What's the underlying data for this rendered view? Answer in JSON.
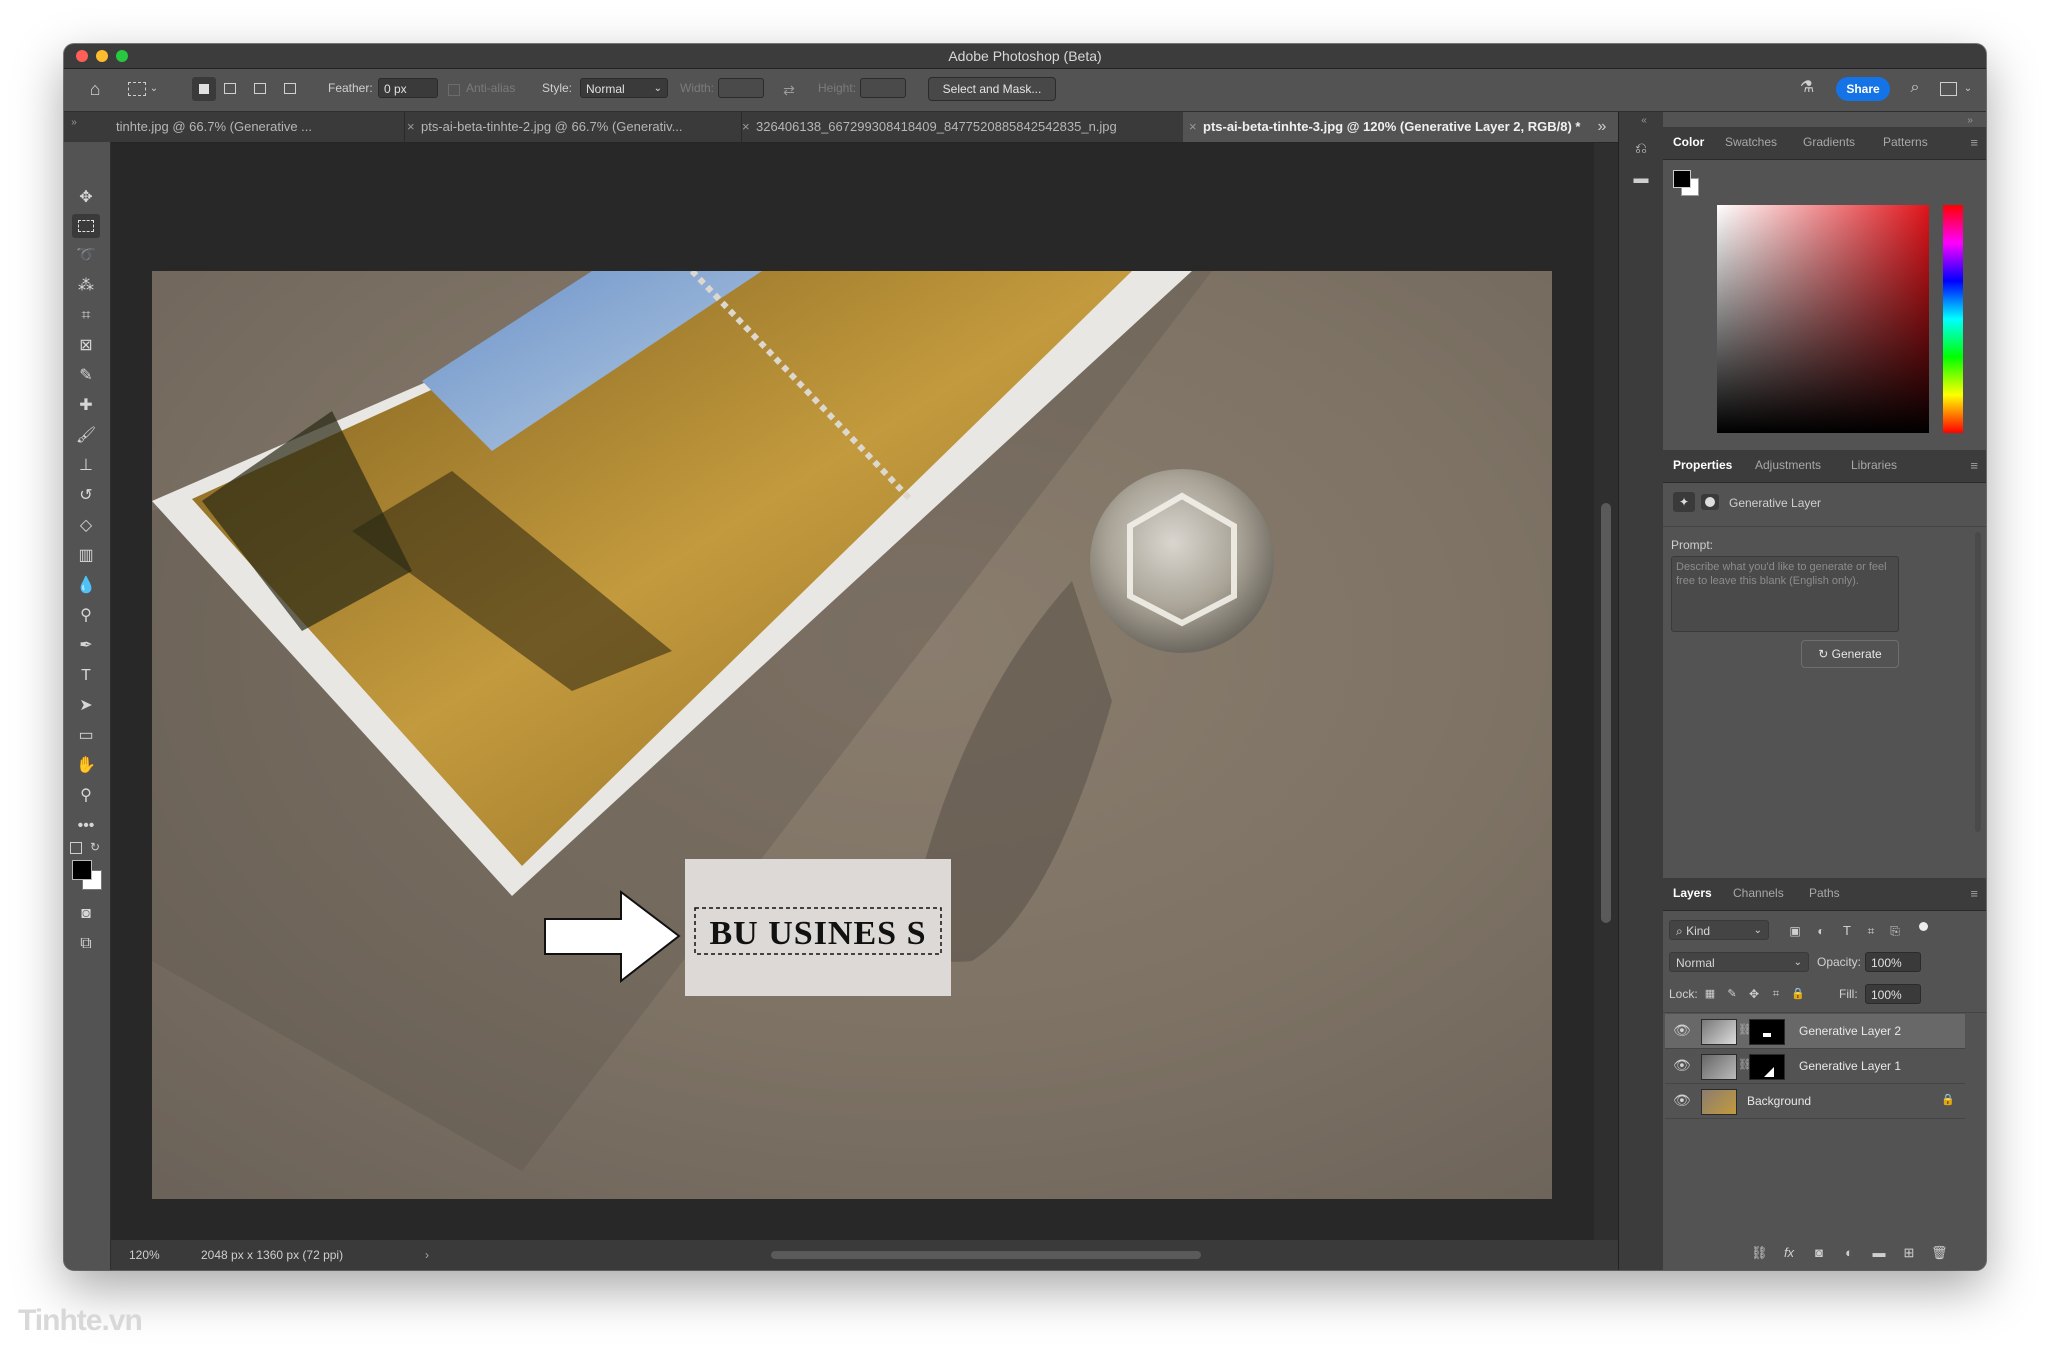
{
  "app": {
    "title": "Adobe Photoshop (Beta)"
  },
  "options_bar": {
    "feather_label": "Feather:",
    "feather_value": "0 px",
    "anti_alias_label": "Anti-alias",
    "style_label": "Style:",
    "style_value": "Normal",
    "width_label": "Width:",
    "height_label": "Height:",
    "select_mask_label": "Select and Mask...",
    "share_label": "Share"
  },
  "tabs": [
    {
      "label": "tinhte.jpg @ 66.7% (Generative ...",
      "active": false
    },
    {
      "label": "pts-ai-beta-tinhte-2.jpg @ 66.7% (Generativ...",
      "active": false
    },
    {
      "label": "326406138_667299308418409_8477520885842542835_n.jpg",
      "active": false
    },
    {
      "label": "pts-ai-beta-tinhte-3.jpg @ 120% (Generative Layer 2, RGB/8) *",
      "active": true
    }
  ],
  "canvas": {
    "card_text": "BU USINES S"
  },
  "status_bar": {
    "zoom": "120%",
    "doc_info": "2048 px x 1360 px (72 ppi)"
  },
  "color_panel": {
    "tabs": [
      "Color",
      "Swatches",
      "Gradients",
      "Patterns"
    ],
    "active_tab": "Color"
  },
  "properties_panel": {
    "tabs": [
      "Properties",
      "Adjustments",
      "Libraries"
    ],
    "layer_type": "Generative Layer",
    "prompt_label": "Prompt:",
    "prompt_placeholder": "Describe what you'd like to generate or feel free to leave this blank (English only).",
    "generate_label": "Generate"
  },
  "layers_panel": {
    "tabs": [
      "Layers",
      "Channels",
      "Paths"
    ],
    "filter_kind": "Kind",
    "blend_mode": "Normal",
    "opacity_label": "Opacity:",
    "opacity_value": "100%",
    "lock_label": "Lock:",
    "fill_label": "Fill:",
    "fill_value": "100%",
    "layers": [
      {
        "name": "Generative Layer 2",
        "selected": true
      },
      {
        "name": "Generative Layer 1",
        "selected": false
      },
      {
        "name": "Background",
        "selected": false
      }
    ]
  },
  "watermark": "Tinhte.vn",
  "colors": {
    "accent": "#1473e6",
    "panel_bg": "#535353",
    "canvas_bg": "#282828"
  }
}
